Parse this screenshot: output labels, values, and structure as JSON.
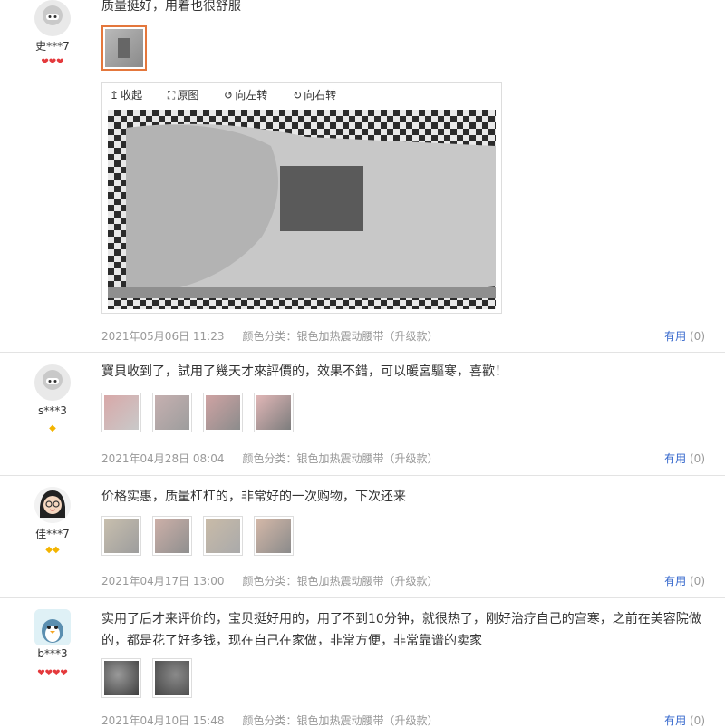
{
  "reviews": [
    {
      "user": "史***7",
      "level": "❤❤❤",
      "content": "质量挺好，用着也很舒服",
      "date": "2021年05月06日 11:23",
      "spec": "颜色分类：银色加热震动腰带（升级款）",
      "useful_label": "有用",
      "useful_count": "(0)"
    },
    {
      "user": "s***3",
      "level": "◆",
      "content": "寶貝收到了，試用了幾天才來評價的，效果不錯，可以暖宮驅寒，喜歡！",
      "date": "2021年04月28日 08:04",
      "spec": "颜色分类：银色加热震动腰带（升级款）",
      "useful_label": "有用",
      "useful_count": "(0)"
    },
    {
      "user": "佳***7",
      "level": "◆◆",
      "content": "价格实惠，质量杠杠的，非常好的一次购物，下次还来",
      "date": "2021年04月17日 13:00",
      "spec": "颜色分类：银色加热震动腰带（升级款）",
      "useful_label": "有用",
      "useful_count": "(0)"
    },
    {
      "user": "b***3",
      "level": "❤❤❤❤",
      "content": "实用了后才来评价的，宝贝挺好用的，用了不到10分钟，就很热了，刚好治疗自己的宫寒，之前在美容院做的，都是花了好多钱，现在自己在家做，非常方便，非常靠谱的卖家",
      "date": "2021年04月10日 15:48",
      "spec": "颜色分类：银色加热震动腰带（升级款）",
      "useful_label": "有用",
      "useful_count": "(0)"
    }
  ],
  "viewer": {
    "collapse": "收起",
    "original": "原图",
    "rotate_left": "向左转",
    "rotate_right": "向右转"
  }
}
